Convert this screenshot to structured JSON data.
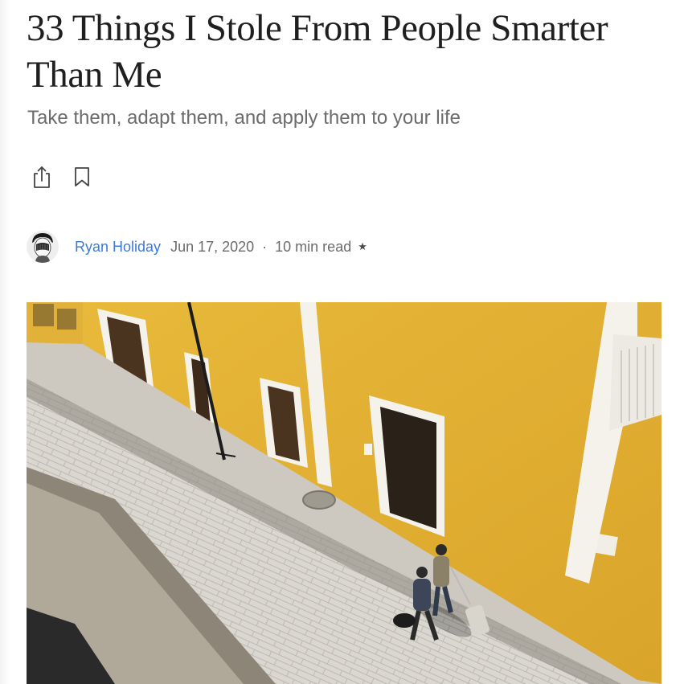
{
  "article": {
    "title": "33 Things I Stole From People Smarter Than Me",
    "subtitle": "Take them, adapt them, and apply them to your life"
  },
  "icons": {
    "share": "share-icon",
    "bookmark": "bookmark-icon",
    "star": "star-icon"
  },
  "byline": {
    "author": "Ryan Holiday",
    "date": "Jun 17, 2020",
    "separator": "·",
    "read_time": "10 min read",
    "star": "★"
  },
  "colors": {
    "title": "#1f1f1f",
    "subtitle": "#6b6b6b",
    "author_link": "#3d7ad6",
    "wall_yellow": "#e7b83b",
    "trim_white": "#f4f2ea",
    "street": "#d6d3cc"
  }
}
